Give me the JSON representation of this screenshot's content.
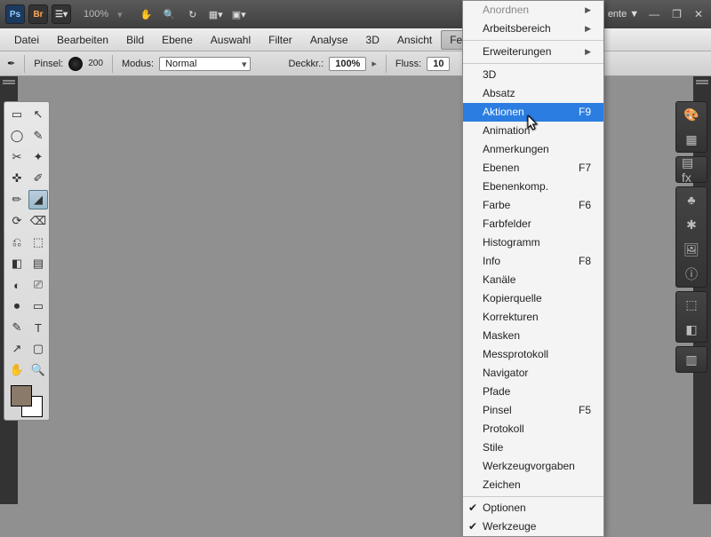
{
  "appbar": {
    "zoom": "100%",
    "workspace": "ente ▼"
  },
  "winbtns": {
    "min": "—",
    "restore": "❐",
    "close": "✕"
  },
  "menubar": [
    "Datei",
    "Bearbeiten",
    "Bild",
    "Ebene",
    "Auswahl",
    "Filter",
    "Analyse",
    "3D",
    "Ansicht",
    "Fenster"
  ],
  "active_menu_index": 9,
  "optbar": {
    "brush_label": "Pinsel:",
    "brush_size": "200",
    "mode_label": "Modus:",
    "mode_value": "Normal",
    "opacity_label": "Deckkr.:",
    "opacity_value": "100%",
    "flow_label": "Fluss:",
    "flow_value": "10"
  },
  "toolbox": [
    "▭",
    "↖",
    "◯",
    "✎",
    "✂",
    "✦",
    "✜",
    "✐",
    "✏",
    "◢",
    "⟳",
    "⌫",
    "⎌",
    "⬚",
    "◧",
    "▤",
    "◐",
    "⎚",
    "⏺",
    "▭",
    "✎",
    "T",
    "↗",
    "▢",
    "✋",
    "🔍"
  ],
  "selected_tool_index": 9,
  "dock_groups": [
    [
      "🎨",
      "▦"
    ],
    [
      "▤ fx"
    ],
    [
      "♣",
      "✱",
      "🖼",
      "ⓘ"
    ],
    [
      "⬚",
      "◧"
    ],
    [
      "▥"
    ]
  ],
  "menu": {
    "top": [
      {
        "label": "Anordnen",
        "disabled": true,
        "arrow": true
      },
      {
        "label": "Arbeitsbereich",
        "arrow": true
      }
    ],
    "ext": [
      {
        "label": "Erweiterungen",
        "arrow": true
      }
    ],
    "panels": [
      {
        "label": "3D"
      },
      {
        "label": "Absatz"
      },
      {
        "label": "Aktionen",
        "shortcut": "F9",
        "hi": true
      },
      {
        "label": "Animation"
      },
      {
        "label": "Anmerkungen"
      },
      {
        "label": "Ebenen",
        "shortcut": "F7"
      },
      {
        "label": "Ebenenkomp."
      },
      {
        "label": "Farbe",
        "shortcut": "F6"
      },
      {
        "label": "Farbfelder"
      },
      {
        "label": "Histogramm"
      },
      {
        "label": "Info",
        "shortcut": "F8"
      },
      {
        "label": "Kanäle"
      },
      {
        "label": "Kopierquelle"
      },
      {
        "label": "Korrekturen"
      },
      {
        "label": "Masken"
      },
      {
        "label": "Messprotokoll"
      },
      {
        "label": "Navigator"
      },
      {
        "label": "Pfade"
      },
      {
        "label": "Pinsel",
        "shortcut": "F5"
      },
      {
        "label": "Protokoll"
      },
      {
        "label": "Stile"
      },
      {
        "label": "Werkzeugvorgaben"
      },
      {
        "label": "Zeichen"
      }
    ],
    "bottom": [
      {
        "label": "Optionen",
        "checked": true
      },
      {
        "label": "Werkzeuge",
        "checked": true
      }
    ]
  }
}
